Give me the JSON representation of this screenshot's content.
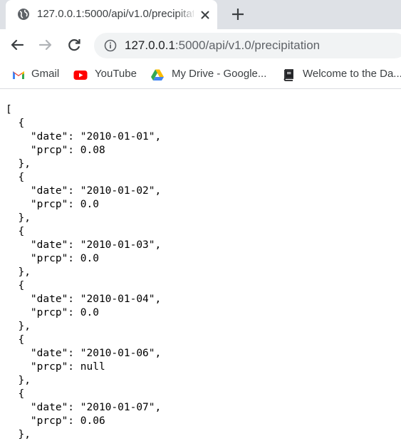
{
  "browser": {
    "tab": {
      "title": "127.0.0.1:5000/api/v1.0/precipitation",
      "favicon": "globe-icon",
      "close_icon": "close-icon"
    },
    "new_tab_icon": "plus-icon",
    "nav": {
      "back_icon": "back-arrow-icon",
      "forward_icon": "forward-arrow-icon",
      "reload_icon": "reload-icon"
    },
    "address_bar": {
      "security_icon": "info-icon",
      "url_host": "127.0.0.1",
      "url_rest": ":5000/api/v1.0/precipitation"
    },
    "bookmarks": [
      {
        "label": "Gmail",
        "icon": "gmail-icon"
      },
      {
        "label": "YouTube",
        "icon": "youtube-icon"
      },
      {
        "label": "My Drive - Google...",
        "icon": "google-drive-icon"
      },
      {
        "label": "Welcome to the Da...",
        "icon": "book-icon"
      }
    ]
  },
  "page": {
    "json_text": "[\n  {\n    \"date\": \"2010-01-01\",\n    \"prcp\": 0.08\n  },\n  {\n    \"date\": \"2010-01-02\",\n    \"prcp\": 0.0\n  },\n  {\n    \"date\": \"2010-01-03\",\n    \"prcp\": 0.0\n  },\n  {\n    \"date\": \"2010-01-04\",\n    \"prcp\": 0.0\n  },\n  {\n    \"date\": \"2010-01-06\",\n    \"prcp\": null\n  },\n  {\n    \"date\": \"2010-01-07\",\n    \"prcp\": 0.06\n  },"
  },
  "colors": {
    "tabstrip": "#dee1e6",
    "omnibox": "#f1f3f4",
    "text_dark": "#202124",
    "text_muted": "#5f6368"
  }
}
